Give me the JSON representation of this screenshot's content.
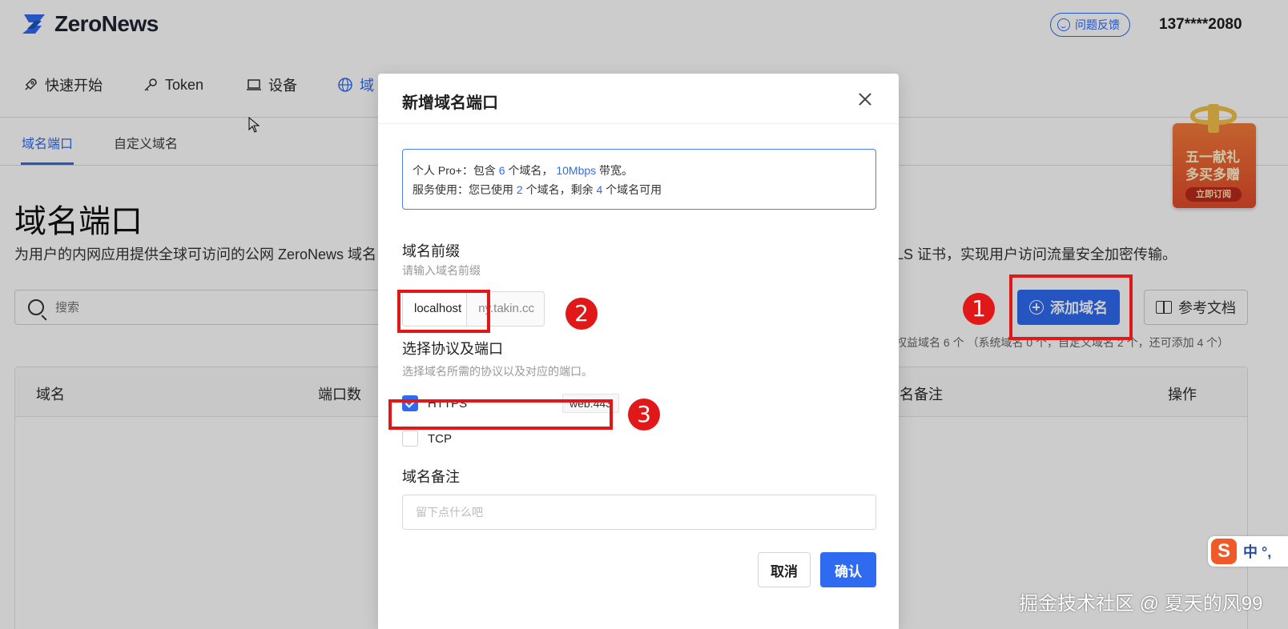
{
  "header": {
    "logo_text": "ZeroNews",
    "feedback_label": "问题反馈",
    "user_phone": "137****2080"
  },
  "nav": {
    "items": [
      {
        "label": "快速开始",
        "icon": "rocket-icon"
      },
      {
        "label": "Token",
        "icon": "key-icon"
      },
      {
        "label": "设备",
        "icon": "laptop-icon"
      },
      {
        "label": "域",
        "icon": "globe-icon"
      }
    ]
  },
  "subtabs": [
    {
      "label": "域名端口",
      "active": true
    },
    {
      "label": "自定义域名",
      "active": false
    }
  ],
  "page": {
    "title": "域名端口",
    "desc_left": "为用户的内网应用提供全球可访问的公网 ZeroNews 域名，",
    "desc_right": "LS 证书，实现用户访问流量安全加密传输。",
    "search_placeholder": "搜索",
    "add_domain_label": "添加域名",
    "docs_label": "参考文档",
    "quota_note": "权益域名 6 个 （系统域名 0 个，自定义域名 2 个，还可添加 4 个）",
    "table_headers": [
      "域名",
      "端口数",
      "名备注",
      "操作"
    ]
  },
  "promo": {
    "line1": "五一献礼",
    "line2": "多买多赠",
    "cta": "立即订阅"
  },
  "modal": {
    "title": "新增域名端口",
    "info_line1_parts": [
      "个人 Pro+：包含 ",
      "6",
      " 个域名， ",
      "10Mbps",
      " 带宽。"
    ],
    "info_line2_parts": [
      "服务使用：您已使用 ",
      "2",
      " 个域名，剩余 ",
      "4",
      " 个域名可用"
    ],
    "prefix_label": "域名前缀",
    "prefix_hint": "请输入域名前缀",
    "prefix_value": "localhost",
    "domain_suffix": "ny.takin.cc",
    "protocol_label": "选择协议及端口",
    "protocol_hint": "选择域名所需的协议以及对应的端口。",
    "protocols": [
      {
        "name": "HTTPS",
        "checked": true,
        "port": "web:443"
      },
      {
        "name": "TCP",
        "checked": false,
        "port": ""
      }
    ],
    "remark_label": "域名备注",
    "remark_placeholder": "留下点什么吧",
    "cancel_label": "取消",
    "confirm_label": "确认"
  },
  "annotations": [
    "1",
    "2",
    "3"
  ],
  "ime": {
    "logo": "S",
    "text": "中 °,"
  },
  "watermark": "掘金技术社区 @ 夏天的风99",
  "colors": {
    "accent": "#2f6bf0",
    "annotation": "#e01818"
  }
}
